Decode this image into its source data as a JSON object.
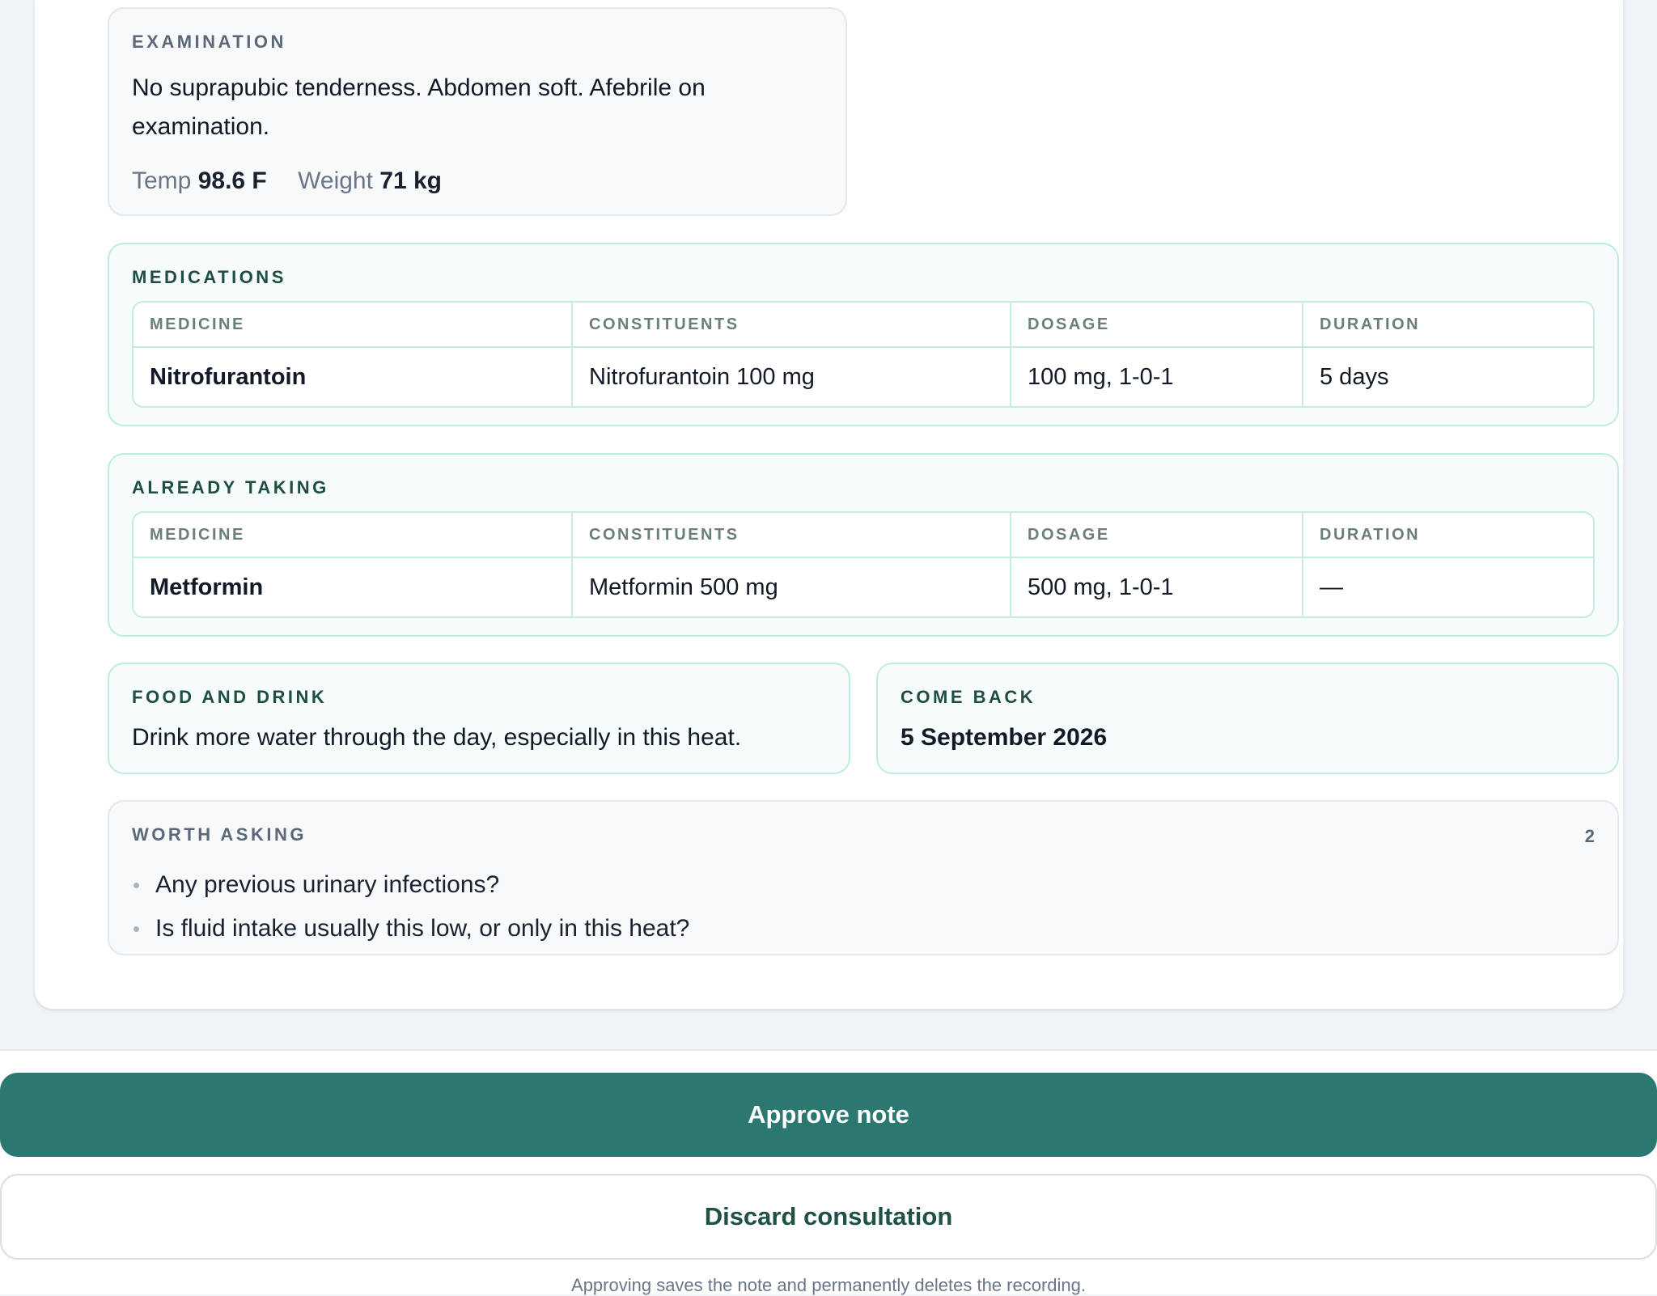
{
  "examination": {
    "label": "Examination",
    "text": "No suprapubic tenderness. Abdomen soft. Afebrile on examination.",
    "temp_label": "Temp",
    "temp_value": "98.6 F",
    "weight_label": "Weight",
    "weight_value": "71 kg"
  },
  "table_headers": {
    "medicine": "MEDICINE",
    "constituents": "CONSTITUENTS",
    "dosage": "DOSAGE",
    "duration": "DURATION"
  },
  "medications": {
    "label": "Medications",
    "rows": [
      {
        "medicine": "Nitrofurantoin",
        "constituents": "Nitrofurantoin 100 mg",
        "dosage": "100 mg, 1-0-1",
        "duration": "5 days"
      }
    ]
  },
  "already_taking": {
    "label": "Already taking",
    "rows": [
      {
        "medicine": "Metformin",
        "constituents": "Metformin 500 mg",
        "dosage": "500 mg, 1-0-1",
        "duration": "—"
      }
    ]
  },
  "food_and_drink": {
    "label": "Food and drink",
    "text": "Drink more water through the day, especially in this heat."
  },
  "come_back": {
    "label": "Come back",
    "date": "5 September 2026"
  },
  "worth_asking": {
    "label": "Worth asking",
    "count": "2",
    "items": [
      "Any previous urinary infections?",
      "Is fluid intake usually this low, or only in this heat?"
    ]
  },
  "actions": {
    "approve_label": "Approve note",
    "discard_label": "Discard consultation",
    "disclaimer": "Approving saves the note and permanently deletes the recording."
  },
  "colors": {
    "accent": "#2b7871",
    "accent_text": "#1f5148",
    "green_border": "#bfece0"
  }
}
